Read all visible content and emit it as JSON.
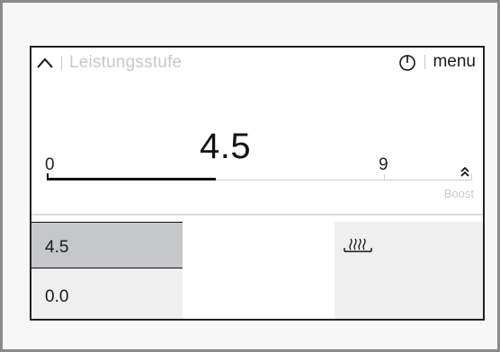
{
  "header": {
    "title": "Leistungsstufe",
    "menu_label": "menu",
    "back_icon": "chevron-up-icon",
    "timer_icon": "timer-icon"
  },
  "power": {
    "current_value": "4.5",
    "min_label": "0",
    "max_label": "9",
    "boost_label": "Boost",
    "boost_icon": "double-chevron-up-icon",
    "level": 4.5,
    "max": 9
  },
  "zones": {
    "zone_a_value": "4.5",
    "zone_b_value": "0.0",
    "right_icon": "heating-icon"
  },
  "colors": {
    "accent": "#111111",
    "muted": "#c8c8c8",
    "selected_zone": "#c5c7c9"
  }
}
